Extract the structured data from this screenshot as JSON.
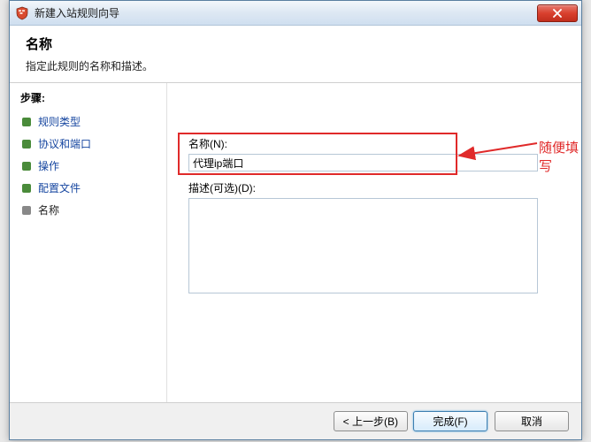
{
  "window": {
    "title": "新建入站规则向导"
  },
  "header": {
    "title": "名称",
    "subtitle": "指定此规则的名称和描述。"
  },
  "sidebar": {
    "steps_label": "步骤:",
    "items": [
      {
        "label": "规则类型"
      },
      {
        "label": "协议和端口"
      },
      {
        "label": "操作"
      },
      {
        "label": "配置文件"
      },
      {
        "label": "名称"
      }
    ]
  },
  "main": {
    "name_label": "名称(N):",
    "name_value": "代理ip端口",
    "desc_label": "描述(可选)(D):",
    "desc_value": ""
  },
  "annotation": {
    "text": "随便填写"
  },
  "footer": {
    "back": "< 上一步(B)",
    "finish": "完成(F)",
    "cancel": "取消"
  }
}
